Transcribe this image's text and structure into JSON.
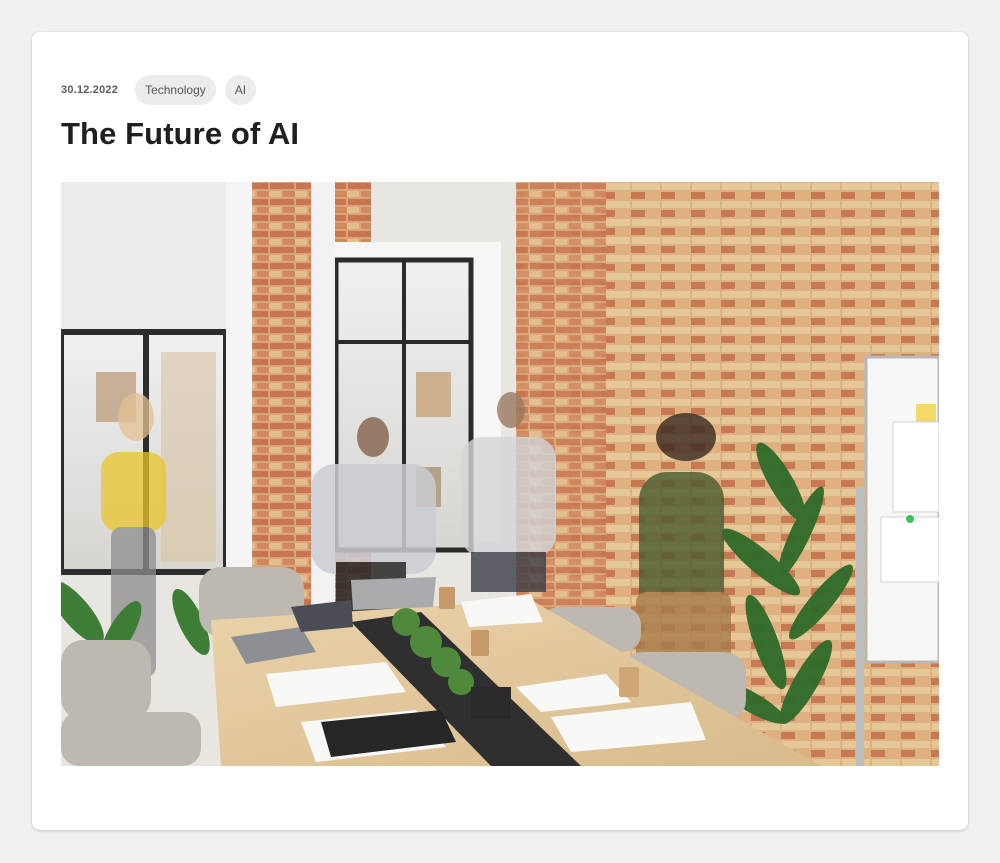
{
  "post": {
    "date": "30.12.2022",
    "tags": [
      {
        "label": "Technology"
      },
      {
        "label": "AI"
      }
    ],
    "title": "The Future of AI"
  },
  "image": {
    "subject": "open office meeting room with brick wall and people in motion"
  },
  "colors": {
    "background": "#f1f1f2",
    "card": "#ffffff",
    "tag_bg": "#ececec",
    "title": "#1f1f1f",
    "date": "#5a5a5a"
  }
}
